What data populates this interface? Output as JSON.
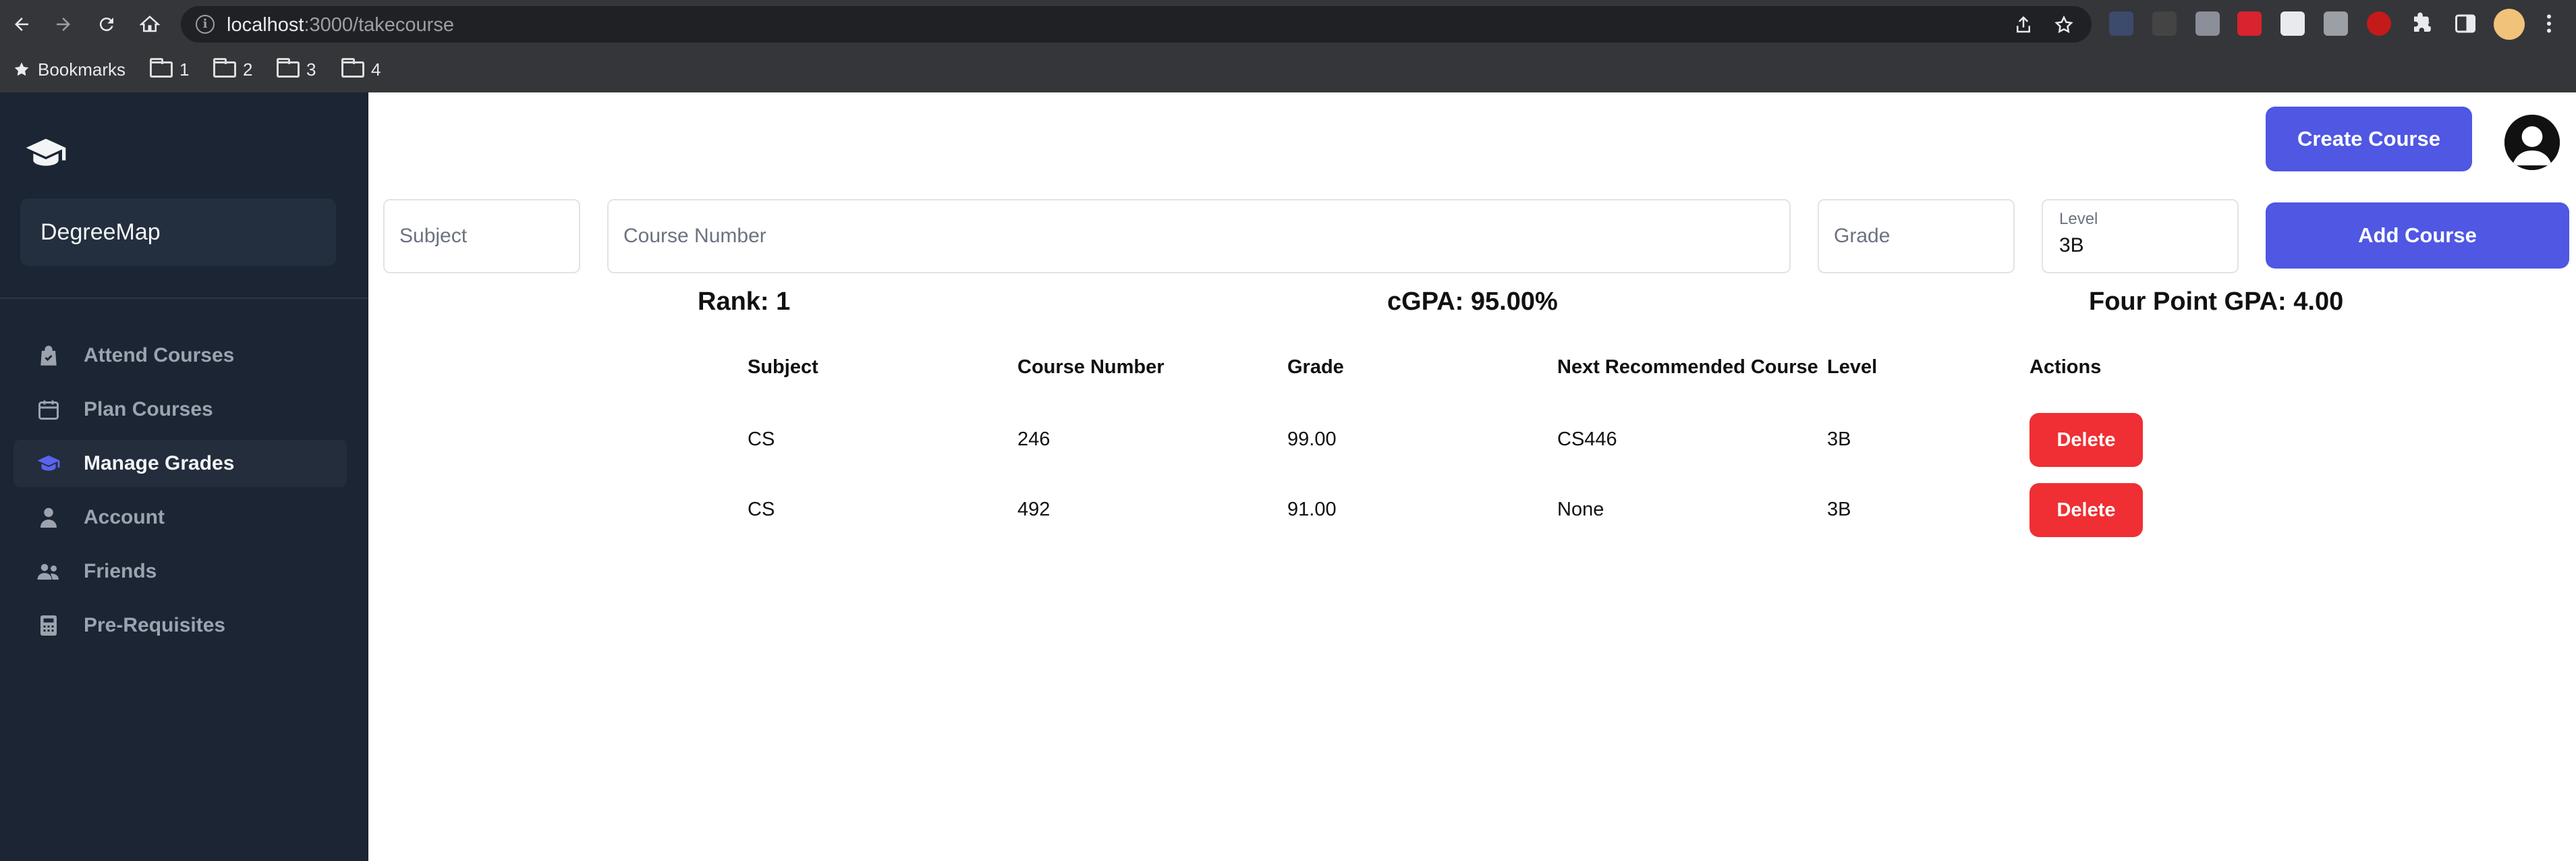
{
  "browser": {
    "url_host": "localhost",
    "url_path": ":3000/takecourse",
    "bookmarks": [
      {
        "label": "Bookmarks"
      },
      {
        "label": "1"
      },
      {
        "label": "2"
      },
      {
        "label": "3"
      },
      {
        "label": "4"
      }
    ]
  },
  "sidebar": {
    "brand_icon": "graduation-cap-icon",
    "app_name": "DegreeMap",
    "items": [
      {
        "label": "Attend Courses",
        "icon": "shopping-bag-icon",
        "active": false
      },
      {
        "label": "Plan Courses",
        "icon": "calendar-icon",
        "active": false
      },
      {
        "label": "Manage Grades",
        "icon": "graduation-cap-icon",
        "active": true
      },
      {
        "label": "Account",
        "icon": "user-icon",
        "active": false
      },
      {
        "label": "Friends",
        "icon": "users-icon",
        "active": false
      },
      {
        "label": "Pre-Requisites",
        "icon": "calculator-icon",
        "active": false
      }
    ]
  },
  "header": {
    "create_course_label": "Create Course"
  },
  "form": {
    "subject_placeholder": "Subject",
    "course_number_placeholder": "Course Number",
    "grade_placeholder": "Grade",
    "level_label": "Level",
    "level_value": "3B",
    "add_course_label": "Add Course"
  },
  "stats": {
    "rank": "Rank: 1",
    "cgpa": "cGPA: 95.00%",
    "four_point": "Four Point GPA: 4.00"
  },
  "table": {
    "headers": [
      "Subject",
      "Course Number",
      "Grade",
      "Next Recommended Course",
      "Level",
      "Actions"
    ],
    "rows": [
      {
        "subject": "CS",
        "course_number": "246",
        "grade": "99.00",
        "next": "CS446",
        "level": "3B",
        "action": "Delete"
      },
      {
        "subject": "CS",
        "course_number": "492",
        "grade": "91.00",
        "next": "None",
        "level": "3B",
        "action": "Delete"
      }
    ]
  },
  "colors": {
    "accent": "#4f57e3",
    "danger": "#ef2f33",
    "sidebar_bg": "#1b2533"
  }
}
